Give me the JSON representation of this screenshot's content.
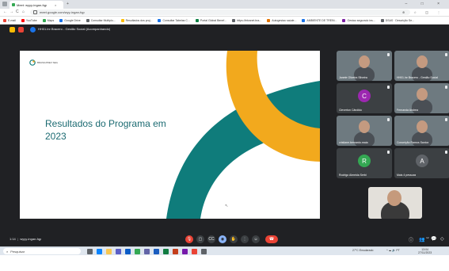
{
  "browser": {
    "tab_title": "Meet: wyyy-ingan-fqp",
    "tab_close": "×",
    "new_tab": "+",
    "window_controls": "– □ ×",
    "nav_back": "←",
    "nav_forward": "→",
    "nav_reload": "C",
    "nav_home": "⌂",
    "url": "meet.google.com/wyy-ingan-fqp",
    "toolbar_icons": "⊕ ☆ ◫ ⋮"
  },
  "bookmarks": [
    {
      "label": "E-mail",
      "color": "#ea4335"
    },
    {
      "label": "YouTube",
      "color": "#ff0000"
    },
    {
      "label": "Maps",
      "color": "#34a853"
    },
    {
      "label": "Google Drive",
      "color": "#1a73e8"
    },
    {
      "label": "Consultar Multiplo...",
      "color": "#5f6368"
    },
    {
      "label": "Resultados dos proj...",
      "color": "#fbbc04"
    },
    {
      "label": "Consultar Tabelas C...",
      "color": "#1a73e8"
    },
    {
      "label": "Portal Global Benef...",
      "color": "#0b8043"
    },
    {
      "label": "https://intranet.bra...",
      "color": "#5f6368"
    },
    {
      "label": "Autogestao saúde...",
      "color": "#e37400"
    },
    {
      "label": "AMBIENTE DE TREIN...",
      "color": "#1a73e8"
    },
    {
      "label": "Gestao segurado ins...",
      "color": "#7b1fa2"
    },
    {
      "label": "DSAS · Descrição Se...",
      "color": "#5f6368"
    }
  ],
  "meet": {
    "meeting_title": "HH01.lnr Bracero - Gestão Social (Acompanhando)",
    "slide": {
      "logo_text": "BRASILPREV SEG",
      "heading": "Resultados do Programa em 2023",
      "colors": {
        "teal": "#0f7c7b",
        "yellow": "#f2a91d",
        "heading": "#1c6b72"
      }
    },
    "participants": [
      {
        "name": "Janete Oliveira Silveira",
        "kind": "video"
      },
      {
        "name": "HH01.lnr Bracero - Gestão Social",
        "kind": "video"
      },
      {
        "name": "Cleverton Cândido",
        "kind": "avatar",
        "initial": "C",
        "color": "#9c27b0"
      },
      {
        "name": "Fernanda Andrea",
        "kind": "video"
      },
      {
        "name": "cristiane.bernardo.maia",
        "kind": "video"
      },
      {
        "name": "Conceição Ramos Santos",
        "kind": "video"
      },
      {
        "name": "Rodrigo Almeida Serbi",
        "kind": "avatar",
        "initial": "R",
        "color": "#34a853"
      },
      {
        "name": "Mais 4 pessoas",
        "kind": "avatar",
        "initial": "A",
        "color": "#5f6368"
      }
    ],
    "time_label": "1:14",
    "meeting_code": "wyyy-ingan-fqp",
    "reactions": [
      "💖",
      "👍",
      "🎉",
      "👏",
      "😂",
      "😮",
      "😢",
      "🤔",
      "👎"
    ],
    "controls": {
      "mic": "🎙",
      "camera": "▢",
      "captions": "CC",
      "present": "◉",
      "raise": "✋",
      "more": "⋮",
      "hangup": "☎"
    },
    "right_controls": {
      "info": "ⓘ",
      "people": "👥",
      "chat": "💬",
      "activities": "◇"
    },
    "participant_count": "12"
  },
  "taskbar": {
    "search_placeholder": "Pesquisar",
    "search_icon": "⌕",
    "weather": "27°C Ensolarado",
    "tray_icons": "^ ☁ 🔊 PT",
    "clock_time": "13:04",
    "clock_date": "27/11/2023",
    "apps": [
      {
        "name": "task-view",
        "color": "#5f6368"
      },
      {
        "name": "edge",
        "color": "#0a84ff"
      },
      {
        "name": "explorer",
        "color": "#f9c74f"
      },
      {
        "name": "store",
        "color": "#5b5fc7"
      },
      {
        "name": "outlook",
        "color": "#0a5cc7"
      },
      {
        "name": "chrome",
        "color": "#34a853"
      },
      {
        "name": "teams",
        "color": "#6264a7"
      },
      {
        "name": "word",
        "color": "#1a5dbf"
      },
      {
        "name": "excel",
        "color": "#107c41"
      },
      {
        "name": "powerpoint",
        "color": "#c43e1c"
      },
      {
        "name": "onenote",
        "color": "#7719aa"
      },
      {
        "name": "chrome-2",
        "color": "#ea4335"
      },
      {
        "name": "settings",
        "color": "#5f6368"
      }
    ]
  }
}
